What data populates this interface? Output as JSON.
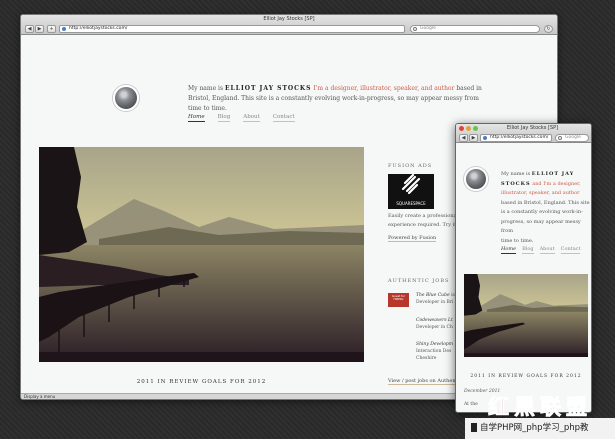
{
  "main_window": {
    "title": "Elliot Jay Stocks [SP]",
    "url": "http://elliotjaystocks.com/",
    "search_placeholder": "Google",
    "status": "Display a menu",
    "intro": {
      "prefix": "My name is",
      "name": "ELLIOT JAY STOCKS",
      "roles": "I'm a designer, illustrator, speaker, and author",
      "line1_end": "based in",
      "line2": "Bristol, England. This site is a constantly evolving work-in-progress, so may appear messy from time to time."
    },
    "nav": [
      "Home",
      "Blog",
      "About",
      "Contact"
    ],
    "fusion_ads": {
      "heading": "FUSION ADS",
      "logo_text": "SQUARESPACE",
      "text_line1": "Easily create a professional",
      "text_line2": "experience required. Try it",
      "link": "Powered by Fusion"
    },
    "authentic_jobs": {
      "heading": "AUTHENTIC JOBS",
      "logo_text": "Guest for HIRING",
      "jobs": [
        {
          "line1": "The Blue Cube",
          "line1_suffix": "is",
          "line2": "Developer in Bri"
        },
        {
          "line1": "Codeweavers Lt",
          "line1_suffix": "",
          "line2": "Developer in Ch"
        },
        {
          "line1": "Shiny Developm",
          "line1_suffix": "",
          "line2": "Interaction Des",
          "line3": "Cheshire"
        }
      ],
      "link": "View / post jobs on Authent"
    },
    "post_title": "2011 IN REVIEW GOALS FOR 2012"
  },
  "small_window": {
    "title": "Elliot Jay Stocks [SP]",
    "url": "http://elliotjaystocks.com/",
    "search_placeholder": "Google",
    "intro_lines": [
      {
        "a": "My name is ",
        "b": "ELLIOT JAY",
        "c": ""
      },
      {
        "a": "",
        "b": "STOCKS",
        "c": " and I'm a designer,"
      },
      {
        "a": "illustrator, speaker, and author",
        "b": "",
        "c": ""
      },
      {
        "a": "based in Bristol, England. This site",
        "b": "",
        "c": ""
      },
      {
        "a": "is a constantly evolving work-in-",
        "b": "",
        "c": ""
      },
      {
        "a": "progress, so may appear messy from",
        "b": "",
        "c": ""
      },
      {
        "a": "time to time.",
        "b": "",
        "c": ""
      }
    ],
    "nav": [
      "Home",
      "Blog",
      "About",
      "Contact"
    ],
    "post_title": "2011 IN REVIEW GOALS FOR 2012",
    "post_date": "December 2011",
    "post_text": "At the"
  },
  "watermark": {
    "logo": "红黑联盟",
    "strip": "自学PHP网_php学习_php教"
  },
  "colors": {
    "accent": "#d05a45",
    "page_bg": "#f6f7f7",
    "desktop_bg": "#2b2b2b"
  },
  "icons": [
    "back-icon",
    "forward-icon",
    "add-icon",
    "globe-icon",
    "search-icon",
    "reload-icon",
    "squarespace-logo-icon"
  ]
}
